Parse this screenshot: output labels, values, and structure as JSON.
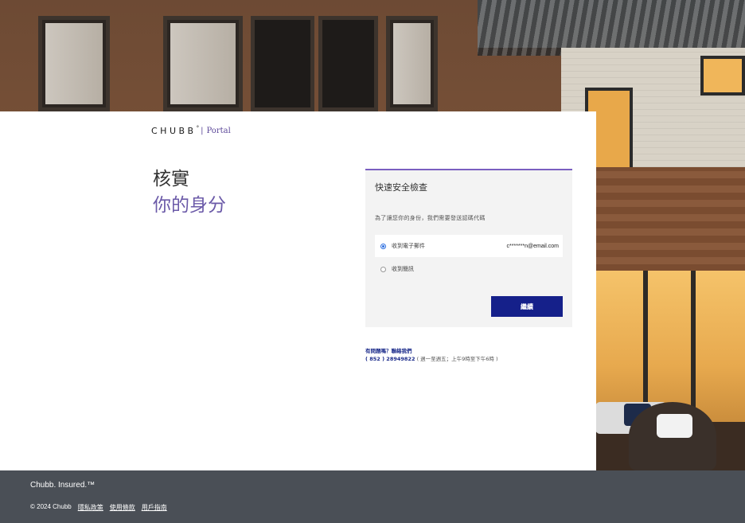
{
  "brand": {
    "logo_text": "CHUBB",
    "logo_mark": "°",
    "separator": "|",
    "portal": "Portal"
  },
  "heading": {
    "line1": "核實",
    "line2": "你的身分"
  },
  "verify_card": {
    "title": "快速安全檢查",
    "subtitle": "為了讓您你的身份，我們需要發送認碼代碼",
    "options": [
      {
        "label": "收到電子郵件",
        "value": "c*******n@email.com",
        "selected": true
      },
      {
        "label": "收到簡訊",
        "value": "",
        "selected": false
      }
    ],
    "continue_label": "繼續"
  },
  "help": {
    "link": "有問題嗎？聯絡我們",
    "phone": "( 852 ) 28949822",
    "hours": "( 週一至週五；上午9時至下午6時 )"
  },
  "footer": {
    "tagline": "Chubb. Insured.™",
    "copyright": "© 2024 Chubb",
    "links": [
      "隱私政策",
      "使用條款",
      "用戶指南"
    ]
  },
  "colors": {
    "accent_purple": "#6b5aa8",
    "button_navy": "#15208a",
    "footer_bg": "#4a4f56"
  }
}
